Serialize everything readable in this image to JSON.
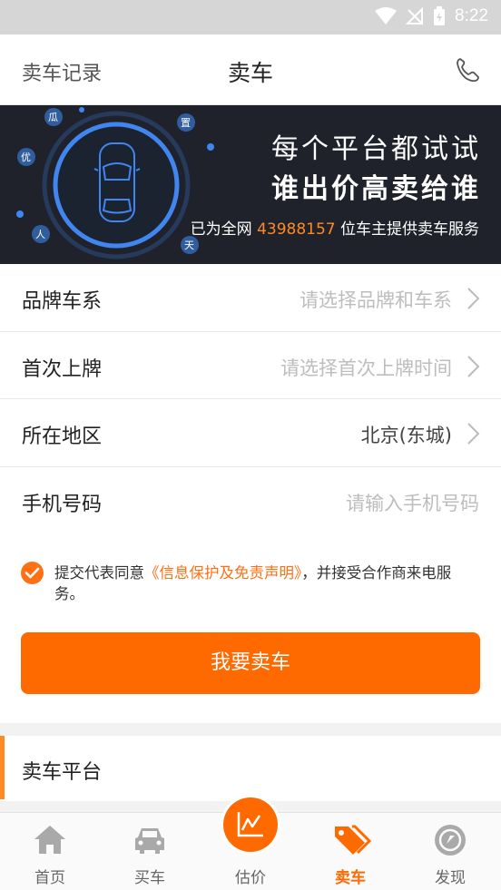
{
  "status_bar": {
    "time": "8:22"
  },
  "header": {
    "left_link": "卖车记录",
    "title": "卖车"
  },
  "banner": {
    "line1": "每个平台都试试",
    "line2": "谁出价高卖给谁",
    "line3_prefix": "已为全网",
    "line3_number": "43988157",
    "line3_suffix": "位车主提供卖车服务",
    "ring_chars": [
      "瓜",
      "置",
      "优",
      "人",
      "天"
    ]
  },
  "form": {
    "rows": [
      {
        "label": "品牌车系",
        "value": "请选择品牌和车系"
      },
      {
        "label": "首次上牌",
        "value": "请选择首次上牌时间"
      },
      {
        "label": "所在地区",
        "value": "北京(东城)"
      },
      {
        "label": "手机号码",
        "value": "请输入手机号码"
      }
    ]
  },
  "agreement": {
    "prefix": "提交代表同意",
    "link": "《信息保护及免责声明》",
    "suffix": "，并接受合作商来电服务。"
  },
  "cta": {
    "label": "我要卖车"
  },
  "section": {
    "title": "卖车平台"
  },
  "tabs": [
    {
      "label": "首页"
    },
    {
      "label": "买车"
    },
    {
      "label": "估价"
    },
    {
      "label": "卖车"
    },
    {
      "label": "发现"
    }
  ],
  "colors": {
    "accent": "#ff6a00",
    "banner_bg": "#1f222b",
    "ring": "#3f86f0"
  }
}
